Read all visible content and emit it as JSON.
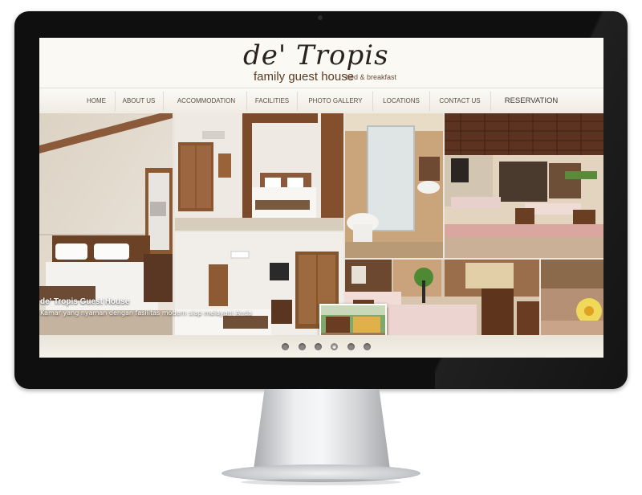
{
  "site": {
    "logo_title": "de' Tropis",
    "logo_subtitle": "family guest house",
    "logo_tagline": "bed & breakfast"
  },
  "nav": {
    "items": [
      {
        "label": "HOME"
      },
      {
        "label": "ABOUT US"
      },
      {
        "label": "ACCOMMODATION"
      },
      {
        "label": "FACILITIES"
      },
      {
        "label": "PHOTO GALLERY"
      },
      {
        "label": "LOCATIONS"
      },
      {
        "label": "CONTACT US"
      },
      {
        "label": "RESERVATION"
      }
    ]
  },
  "slider": {
    "caption_title": "de' Tropis Guest House",
    "caption_text": "Kamar yang nyaman dengan fasilitas modern siap melayani Anda",
    "slide_count": 6,
    "active_slide": 4
  },
  "colors": {
    "accent": "#5a3a24",
    "nav_text": "#5a4e44",
    "header_bg": "#fbf9f4"
  }
}
